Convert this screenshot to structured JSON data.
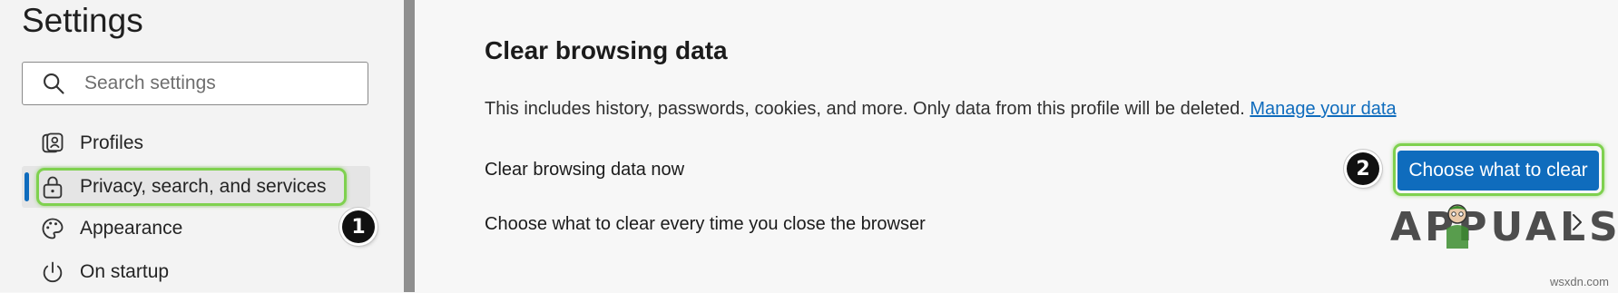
{
  "sidebar": {
    "title": "Settings",
    "search": {
      "placeholder": "Search settings"
    },
    "items": [
      {
        "label": "Profiles",
        "icon": "profiles-icon"
      },
      {
        "label": "Privacy, search, and services",
        "icon": "lock-icon",
        "selected": true
      },
      {
        "label": "Appearance",
        "icon": "palette-icon"
      },
      {
        "label": "On startup",
        "icon": "power-icon"
      }
    ]
  },
  "main": {
    "section_title": "Clear browsing data",
    "description": "This includes history, passwords, cookies, and more. Only data from this profile will be deleted.",
    "manage_link": "Manage your data",
    "rows": [
      {
        "label": "Clear browsing data now",
        "button": "Choose what to clear"
      },
      {
        "label": "Choose what to clear every time you close the browser"
      }
    ]
  },
  "annotations": {
    "step1": "1",
    "step2": "2",
    "highlight_color": "#7fd14f"
  },
  "watermark": "APPUALS",
  "site": "wsxdn.com",
  "colors": {
    "accent": "#0f6cbd"
  }
}
